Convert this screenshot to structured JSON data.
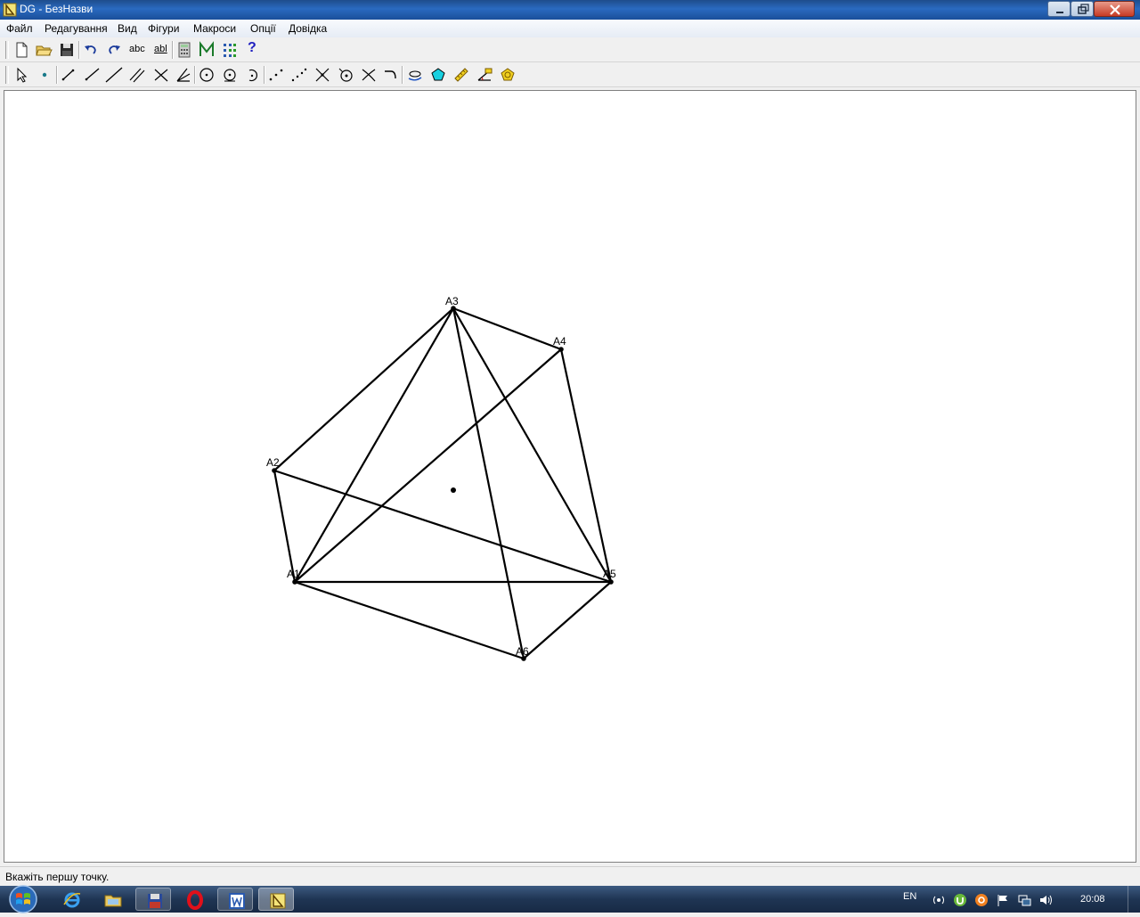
{
  "window": {
    "title": "DG - БезНазви"
  },
  "menubar": {
    "items": [
      "Файл",
      "Редагування",
      "Вид",
      "Фігури",
      "Макроси",
      "Опції",
      "Довідка"
    ]
  },
  "toolbar1": {
    "text_buttons": [
      "abc",
      "abl"
    ],
    "help_label": "?"
  },
  "drawing": {
    "points": [
      {
        "label": "A1"
      },
      {
        "label": "A2"
      },
      {
        "label": "A3"
      },
      {
        "label": "A4"
      },
      {
        "label": "A5"
      },
      {
        "label": "A6"
      }
    ]
  },
  "statusbar": {
    "text": "Вкажіть першу точку."
  },
  "taskbar": {
    "language": "EN",
    "clock": "20:08"
  },
  "colors": {
    "titlebar": "#1e4d8c",
    "canvas_background": "#ffffff",
    "figure_stroke": "#000000",
    "taskbar": "#1f3554"
  }
}
